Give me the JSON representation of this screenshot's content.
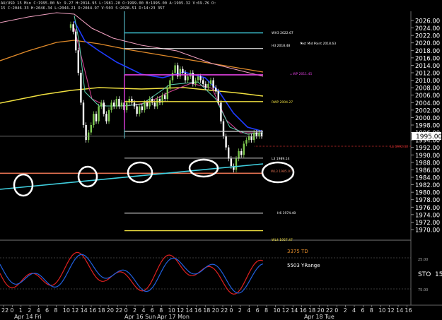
{
  "header": {
    "row1": "AU/USD 15 Min  C:1995.00  N: 9.27  H:2014.95  L:1981.20  O:1999.00  B:1995.00  A:1995.32  V:69.7K  O:",
    "row2": "15  C:2046.33  H:2046.34  L:2044.21  O:2044.97  V:503  S:2028.51  D:14:23  357"
  },
  "price_axis": {
    "ticks": [
      "2026.00",
      "2024.00",
      "2022.00",
      "2020.00",
      "2018.00",
      "2016.00",
      "2014.00",
      "2012.00",
      "2010.00",
      "2008.00",
      "2006.00",
      "2004.00",
      "2002.00",
      "2000.00",
      "1998.00",
      "1996.00",
      "1994.00",
      "1992.00",
      "1990.00",
      "1988.00",
      "1986.00",
      "1984.00",
      "1982.00",
      "1980.00",
      "1978.00",
      "1976.00",
      "1974.00",
      "1972.00",
      "1970.00"
    ],
    "last_price": "1995.00"
  },
  "level_labels": {
    "wh3": "WH3 2022.67",
    "h3": "H3 2018.48",
    "yest_mid": "Yest Mid Point 2018.63",
    "wp": "WP 2011.45",
    "rwp": "RWP 2004.27",
    "ll": "LL 1992.32",
    "l3": "L3 1989.14",
    "wl3": "WL3 1985.07",
    "h6": "H6 1974.40",
    "wl4": "WL4 1957.47"
  },
  "indicator": {
    "td": "3375 TD",
    "yrange": "5503 YRange",
    "name": "STO",
    "name_value": "15",
    "tick_top": "25.00",
    "tick_bottom": "75.00"
  },
  "time_axis": {
    "hour_labels": [
      "22",
      "0",
      "1",
      "2",
      "4",
      "6",
      "8",
      "10",
      "12",
      "14",
      "16",
      "18",
      "20",
      "22",
      "0",
      "2",
      "4",
      "6",
      "8",
      "10",
      "12",
      "14",
      "16",
      "18",
      "20",
      "22",
      "0",
      "2",
      "4",
      "6",
      "8",
      "10",
      "12",
      "14",
      "16",
      "18",
      "20",
      "22",
      "0",
      "2",
      "4",
      "6",
      "8",
      "10",
      "12",
      "14",
      "16"
    ],
    "day_labels": [
      "Apr 14 Fri",
      "Apr 16 Sun",
      "Apr 17 Mon",
      "Apr 18 Tue"
    ]
  },
  "colors": {
    "background": "#000000",
    "candle_up": "#7ec850",
    "candle_down": "#ffffff",
    "ema_blue": "#1e3cff",
    "ema_magenta": "#d04090",
    "ema_orange": "#e08a2a",
    "ema_yellow": "#f0e040",
    "ema_pink": "#f0a0c0",
    "ema_teal": "#5fd0b0",
    "trend_cyan": "#40d0e0",
    "level_orange": "#e07050",
    "level_magenta": "#e040e0",
    "stoch_red": "#e02020",
    "stoch_blue": "#2060e0",
    "circle": "#ffffff"
  },
  "chart_data": {
    "type": "line",
    "title": "",
    "xlabel": "",
    "ylabel": "",
    "ylim": [
      1970,
      2026
    ],
    "x": [
      "Apr 14 12:00",
      "Apr 14 14:00",
      "Apr 14 16:00",
      "Apr 17 02:00",
      "Apr 17 05:00",
      "Apr 17 08:00",
      "Apr 17 10:00",
      "Apr 17 11:00",
      "Apr 17 13:00",
      "Apr 17 16:00"
    ],
    "series": [
      {
        "values": [
          2024,
          1996,
          1997,
          2003,
          2012,
          2008,
          1996,
          1987,
          1988,
          1995
        ]
      }
    ],
    "levels": [
      {
        "label": "WH3",
        "value": 2022.67
      },
      {
        "label": "H3",
        "value": 2018.48
      },
      {
        "label": "Yest Mid Point",
        "value": 2018.63
      },
      {
        "label": "WP",
        "value": 2011.45
      },
      {
        "label": "RWP",
        "value": 2004.27
      },
      {
        "label": "LL",
        "value": 1992.32
      },
      {
        "label": "L3",
        "value": 1989.14
      },
      {
        "label": "WL3",
        "value": 1985.07
      },
      {
        "label": "H6",
        "value": 1974.4
      },
      {
        "label": "WL4",
        "value": 1957.47
      }
    ]
  }
}
